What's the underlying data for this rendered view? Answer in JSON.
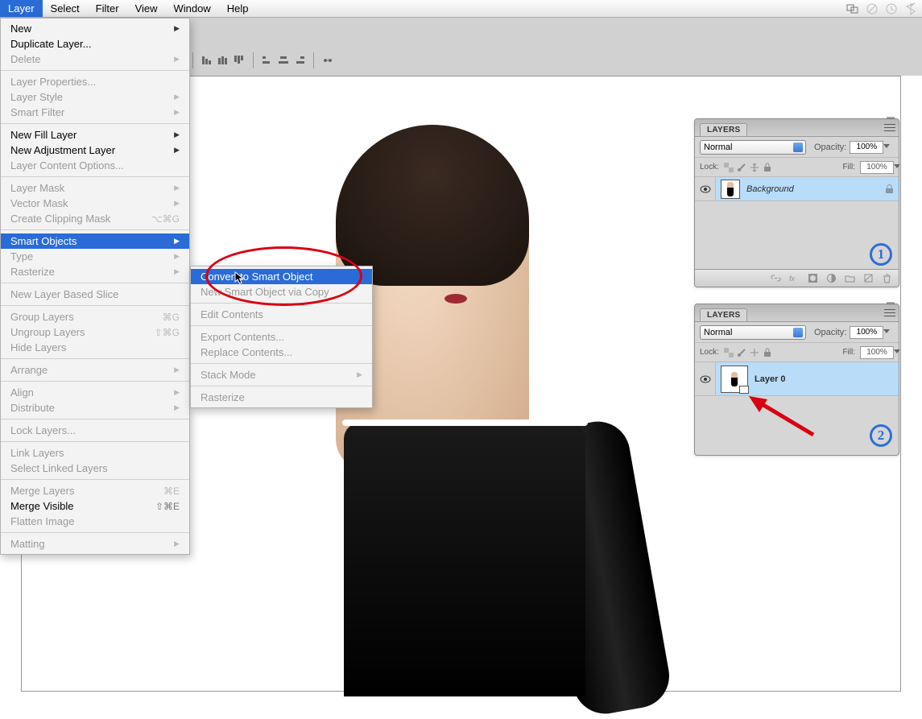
{
  "menubar": {
    "items": [
      "Layer",
      "Select",
      "Filter",
      "View",
      "Window",
      "Help"
    ],
    "active_index": 0
  },
  "menu": {
    "groups": [
      [
        {
          "label": "New",
          "arrow": true
        },
        {
          "label": "Duplicate Layer..."
        },
        {
          "label": "Delete",
          "arrow": true,
          "disabled": true
        }
      ],
      [
        {
          "label": "Layer Properties...",
          "disabled": true
        },
        {
          "label": "Layer Style",
          "arrow": true,
          "disabled": true
        },
        {
          "label": "Smart Filter",
          "arrow": true,
          "disabled": true
        }
      ],
      [
        {
          "label": "New Fill Layer",
          "arrow": true
        },
        {
          "label": "New Adjustment Layer",
          "arrow": true
        },
        {
          "label": "Layer Content Options...",
          "disabled": true
        }
      ],
      [
        {
          "label": "Layer Mask",
          "arrow": true,
          "disabled": true
        },
        {
          "label": "Vector Mask",
          "arrow": true,
          "disabled": true
        },
        {
          "label": "Create Clipping Mask",
          "shortcut": "⌥⌘G",
          "disabled": true
        }
      ],
      [
        {
          "label": "Smart Objects",
          "arrow": true,
          "highlighted": true
        },
        {
          "label": "Type",
          "arrow": true,
          "disabled": true
        },
        {
          "label": "Rasterize",
          "arrow": true,
          "disabled": true
        }
      ],
      [
        {
          "label": "New Layer Based Slice",
          "disabled": true
        }
      ],
      [
        {
          "label": "Group Layers",
          "shortcut": "⌘G",
          "disabled": true
        },
        {
          "label": "Ungroup Layers",
          "shortcut": "⇧⌘G",
          "disabled": true
        },
        {
          "label": "Hide Layers",
          "disabled": true
        }
      ],
      [
        {
          "label": "Arrange",
          "arrow": true,
          "disabled": true
        }
      ],
      [
        {
          "label": "Align",
          "arrow": true,
          "disabled": true
        },
        {
          "label": "Distribute",
          "arrow": true,
          "disabled": true
        }
      ],
      [
        {
          "label": "Lock Layers...",
          "disabled": true
        }
      ],
      [
        {
          "label": "Link Layers",
          "disabled": true
        },
        {
          "label": "Select Linked Layers",
          "disabled": true
        }
      ],
      [
        {
          "label": "Merge Layers",
          "shortcut": "⌘E",
          "disabled": true
        },
        {
          "label": "Merge Visible",
          "shortcut": "⇧⌘E"
        },
        {
          "label": "Flatten Image",
          "disabled": true
        }
      ],
      [
        {
          "label": "Matting",
          "arrow": true,
          "disabled": true
        }
      ]
    ]
  },
  "submenu": {
    "groups": [
      [
        {
          "label": "Convert to Smart Object",
          "highlighted": true
        },
        {
          "label": "New Smart Object via Copy",
          "disabled": true
        }
      ],
      [
        {
          "label": "Edit Contents",
          "disabled": true
        }
      ],
      [
        {
          "label": "Export Contents...",
          "disabled": true
        },
        {
          "label": "Replace Contents...",
          "disabled": true
        }
      ],
      [
        {
          "label": "Stack Mode",
          "arrow": true,
          "disabled": true
        }
      ],
      [
        {
          "label": "Rasterize",
          "disabled": true
        }
      ]
    ]
  },
  "layers_panel": {
    "title": "LAYERS",
    "blend_mode": "Normal",
    "opacity_label": "Opacity:",
    "opacity_value": "100%",
    "lock_label": "Lock:",
    "fill_label": "Fill:",
    "fill_value": "100%"
  },
  "panel1": {
    "layer_name": "Background",
    "annotation": "1"
  },
  "panel2": {
    "layer_name": "Layer 0",
    "annotation": "2"
  }
}
